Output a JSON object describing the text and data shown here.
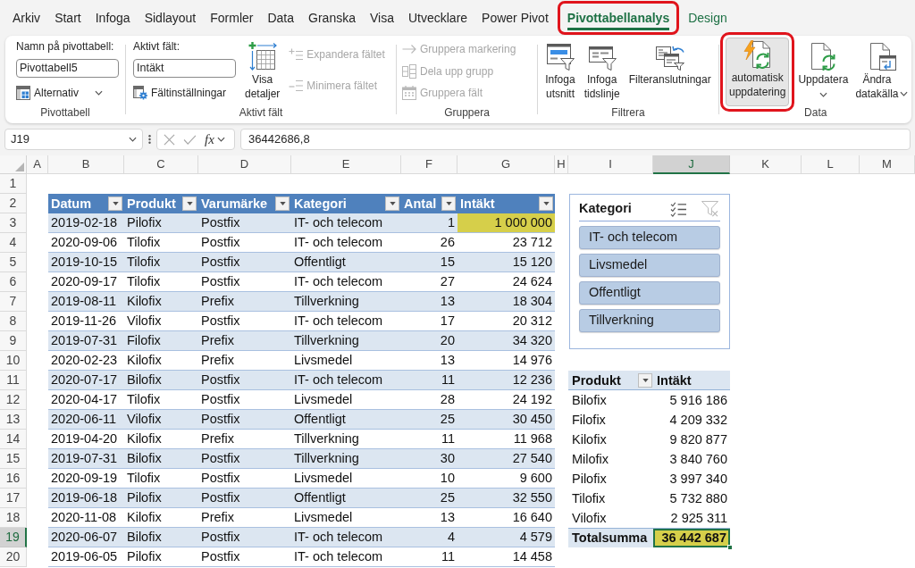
{
  "ribbon_tabs": [
    {
      "label": "Arkiv",
      "kind": "standard",
      "selected": false,
      "highlighted": false
    },
    {
      "label": "Start",
      "kind": "standard",
      "selected": false,
      "highlighted": false
    },
    {
      "label": "Infoga",
      "kind": "standard",
      "selected": false,
      "highlighted": false
    },
    {
      "label": "Sidlayout",
      "kind": "standard",
      "selected": false,
      "highlighted": false
    },
    {
      "label": "Formler",
      "kind": "standard",
      "selected": false,
      "highlighted": false
    },
    {
      "label": "Data",
      "kind": "standard",
      "selected": false,
      "highlighted": false
    },
    {
      "label": "Granska",
      "kind": "standard",
      "selected": false,
      "highlighted": false
    },
    {
      "label": "Visa",
      "kind": "standard",
      "selected": false,
      "highlighted": false
    },
    {
      "label": "Utvecklare",
      "kind": "standard",
      "selected": false,
      "highlighted": false
    },
    {
      "label": "Power Pivot",
      "kind": "standard",
      "selected": false,
      "highlighted": false
    },
    {
      "label": "Pivottabellanalys",
      "kind": "contextual",
      "selected": true,
      "highlighted": true
    },
    {
      "label": "Design",
      "kind": "contextual",
      "selected": false,
      "highlighted": false
    }
  ],
  "ribbon_groups": [
    {
      "label": "Pivottabell",
      "columns": [
        {
          "kind": "stack",
          "items": [
            {
              "kind": "caption",
              "text": "Namn på pivottabell:"
            },
            {
              "kind": "field",
              "value": "Pivottabell5"
            },
            {
              "kind": "menu_button",
              "label": "Alternativ",
              "disabled": false
            }
          ]
        }
      ]
    },
    {
      "label": "Aktivt fält",
      "columns": [
        {
          "kind": "stack",
          "items": [
            {
              "kind": "caption",
              "text": "Aktivt fält:"
            },
            {
              "kind": "field",
              "value": "Intäkt"
            },
            {
              "kind": "button",
              "label": "Fältinställningar",
              "disabled": false
            }
          ]
        },
        {
          "kind": "large_button",
          "label": "Visa detaljer",
          "pressed": false,
          "highlighted": false
        },
        {
          "kind": "stack",
          "items": [
            {
              "kind": "button",
              "label": "Expandera fältet",
              "disabled": true
            },
            {
              "kind": "button",
              "label": "Minimera fältet",
              "disabled": true
            }
          ]
        }
      ]
    },
    {
      "label": "Gruppera",
      "columns": [
        {
          "kind": "stack",
          "items": [
            {
              "kind": "button",
              "label": "Gruppera markering",
              "disabled": true
            },
            {
              "kind": "button",
              "label": "Dela upp grupp",
              "disabled": true
            },
            {
              "kind": "button",
              "label": "Gruppera fält",
              "disabled": true
            }
          ]
        }
      ]
    },
    {
      "label": "Filtrera",
      "columns": [
        {
          "kind": "large_button",
          "label": "Infoga utsnitt",
          "pressed": false,
          "highlighted": false
        },
        {
          "kind": "large_button",
          "label": "Infoga tidslinje",
          "pressed": false,
          "highlighted": false
        },
        {
          "kind": "large_button",
          "label": "Filteranslutningar",
          "pressed": false,
          "highlighted": false
        }
      ]
    },
    {
      "label": "Data",
      "columns": [
        {
          "kind": "large_button",
          "label": "automatisk uppdatering",
          "pressed": true,
          "highlighted": true
        },
        {
          "kind": "large_split_button",
          "label": "Uppdatera",
          "pressed": false,
          "highlighted": false
        },
        {
          "kind": "large_menu_button",
          "label": "Ändra datakälla",
          "pressed": false,
          "highlighted": false
        }
      ]
    }
  ],
  "formula_bar": {
    "name_box": "J19",
    "function_label": "fx",
    "formula": "36442686,8"
  },
  "column_headers": [
    {
      "label": "A",
      "selected": false
    },
    {
      "label": "B",
      "selected": false
    },
    {
      "label": "C",
      "selected": false
    },
    {
      "label": "D",
      "selected": false
    },
    {
      "label": "E",
      "selected": false
    },
    {
      "label": "F",
      "selected": false
    },
    {
      "label": "G",
      "selected": false
    },
    {
      "label": "H",
      "selected": false
    },
    {
      "label": "I",
      "selected": false
    },
    {
      "label": "J",
      "selected": true
    },
    {
      "label": "K",
      "selected": false
    },
    {
      "label": "L",
      "selected": false
    },
    {
      "label": "M",
      "selected": false
    }
  ],
  "row_headers": [
    {
      "label": "1",
      "selected": false
    },
    {
      "label": "2",
      "selected": false
    },
    {
      "label": "3",
      "selected": false
    },
    {
      "label": "4",
      "selected": false
    },
    {
      "label": "5",
      "selected": false
    },
    {
      "label": "6",
      "selected": false
    },
    {
      "label": "7",
      "selected": false
    },
    {
      "label": "8",
      "selected": false
    },
    {
      "label": "9",
      "selected": false
    },
    {
      "label": "10",
      "selected": false
    },
    {
      "label": "11",
      "selected": false
    },
    {
      "label": "12",
      "selected": false
    },
    {
      "label": "13",
      "selected": false
    },
    {
      "label": "14",
      "selected": false
    },
    {
      "label": "15",
      "selected": false
    },
    {
      "label": "16",
      "selected": false
    },
    {
      "label": "17",
      "selected": false
    },
    {
      "label": "18",
      "selected": false
    },
    {
      "label": "19",
      "selected": true
    },
    {
      "label": "20",
      "selected": false
    }
  ],
  "table": {
    "columns": [
      "Datum",
      "Produkt",
      "Varumärke",
      "Kategori",
      "Antal",
      "Intäkt"
    ],
    "rows": [
      {
        "cells": [
          "2019-02-18",
          "Pilofix",
          "Postfix",
          "IT- och telecom",
          "1",
          "1 000 000"
        ],
        "highlighted": true
      },
      {
        "cells": [
          "2020-09-06",
          "Tilofix",
          "Postfix",
          "IT- och telecom",
          "26",
          "23 712"
        ],
        "highlighted": false
      },
      {
        "cells": [
          "2019-10-15",
          "Tilofix",
          "Postfix",
          "Offentligt",
          "15",
          "15 120"
        ],
        "highlighted": false
      },
      {
        "cells": [
          "2020-09-17",
          "Tilofix",
          "Postfix",
          "IT- och telecom",
          "27",
          "24 624"
        ],
        "highlighted": false
      },
      {
        "cells": [
          "2019-08-11",
          "Kilofix",
          "Prefix",
          "Tillverkning",
          "13",
          "18 304"
        ],
        "highlighted": false
      },
      {
        "cells": [
          "2019-11-26",
          "Vilofix",
          "Postfix",
          "IT- och telecom",
          "17",
          "20 312"
        ],
        "highlighted": false
      },
      {
        "cells": [
          "2019-07-31",
          "Filofix",
          "Prefix",
          "Tillverkning",
          "20",
          "34 320"
        ],
        "highlighted": false
      },
      {
        "cells": [
          "2020-02-23",
          "Kilofix",
          "Prefix",
          "Livsmedel",
          "13",
          "14 976"
        ],
        "highlighted": false
      },
      {
        "cells": [
          "2020-07-17",
          "Bilofix",
          "Postfix",
          "IT- och telecom",
          "11",
          "12 236"
        ],
        "highlighted": false
      },
      {
        "cells": [
          "2020-04-17",
          "Tilofix",
          "Postfix",
          "Livsmedel",
          "28",
          "24 192"
        ],
        "highlighted": false
      },
      {
        "cells": [
          "2020-06-11",
          "Vilofix",
          "Postfix",
          "Offentligt",
          "25",
          "30 450"
        ],
        "highlighted": false
      },
      {
        "cells": [
          "2019-04-20",
          "Kilofix",
          "Prefix",
          "Tillverkning",
          "11",
          "11 968"
        ],
        "highlighted": false
      },
      {
        "cells": [
          "2019-07-31",
          "Bilofix",
          "Postfix",
          "Tillverkning",
          "30",
          "27 540"
        ],
        "highlighted": false
      },
      {
        "cells": [
          "2020-09-19",
          "Tilofix",
          "Postfix",
          "Livsmedel",
          "10",
          "9 600"
        ],
        "highlighted": false
      },
      {
        "cells": [
          "2019-06-18",
          "Pilofix",
          "Postfix",
          "Offentligt",
          "25",
          "32 550"
        ],
        "highlighted": false
      },
      {
        "cells": [
          "2020-11-08",
          "Kilofix",
          "Prefix",
          "Livsmedel",
          "13",
          "16 640"
        ],
        "highlighted": false
      },
      {
        "cells": [
          "2020-06-07",
          "Bilofix",
          "Postfix",
          "IT- och telecom",
          "4",
          "4 579"
        ],
        "highlighted": false
      },
      {
        "cells": [
          "2019-06-05",
          "Pilofix",
          "Postfix",
          "IT- och telecom",
          "11",
          "14 458"
        ],
        "highlighted": false
      }
    ]
  },
  "slicer": {
    "title": "Kategori",
    "items": [
      {
        "label": "IT- och telecom",
        "selected": true
      },
      {
        "label": "Livsmedel",
        "selected": true
      },
      {
        "label": "Offentligt",
        "selected": true
      },
      {
        "label": "Tillverkning",
        "selected": true
      }
    ]
  },
  "pivot_table": {
    "columns": [
      "Produkt",
      "Intäkt"
    ],
    "rows": [
      [
        "Bilofix",
        "5 916 186"
      ],
      [
        "Filofix",
        "4 209 332"
      ],
      [
        "Kilofix",
        "9 820 877"
      ],
      [
        "Milofix",
        "3 840 760"
      ],
      [
        "Pilofix",
        "3 997 340"
      ],
      [
        "Tilofix",
        "5 732 880"
      ],
      [
        "Vilofix",
        "2 925 311"
      ]
    ],
    "total": {
      "cells": [
        "Totalsumma",
        "36 442 687"
      ],
      "highlighted": true,
      "selected": true
    }
  }
}
